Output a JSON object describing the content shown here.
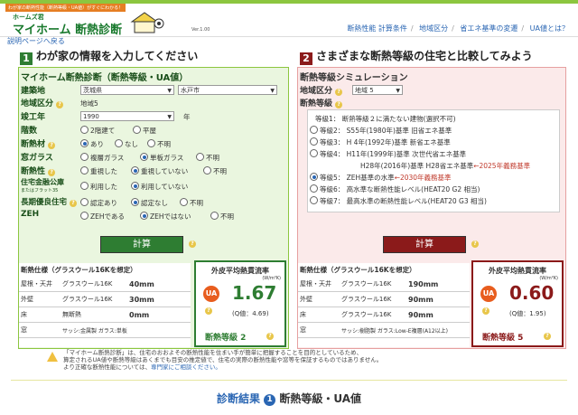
{
  "header": {
    "tagline": "わが家の断熱性能（断熱等級・UA値）がすぐにわかる！",
    "logo_small": "ホームズ君",
    "logo_main": "マイホーム 断熱診断",
    "version": "Ver.1.00",
    "nav": [
      "断熱性能 計算条件",
      "地域区分",
      "省エネ基準の変遷",
      "UA値とは？"
    ]
  },
  "back_link": "説明ページへ戻る",
  "left": {
    "section_num": "1",
    "section_title": "わが家の情報を入力してください",
    "panel_title": "マイホーム断熱診断（断熱等級・UA値）",
    "fields": {
      "location_label": "建築地",
      "prefecture": "茨城県",
      "city": "水戸市",
      "region_label": "地域区分",
      "region_value": "地域5",
      "year_label": "竣工年",
      "year_value": "1990",
      "year_unit": "年",
      "floors_label": "階数",
      "floors_opts": [
        "2階建て",
        "平屋"
      ],
      "insul_label": "断熱材",
      "insul_opts": [
        "あり",
        "なし",
        "不明"
      ],
      "window_label": "窓ガラス",
      "window_opts": [
        "複層ガラス",
        "単板ガラス",
        "不明"
      ],
      "renov_label": "断熱性",
      "renov_opts": [
        "重視した",
        "重視していない",
        "不明"
      ],
      "loan_label": "住宅金融公庫",
      "loan_sub": "またはフラット35",
      "loan_opts": [
        "利用した",
        "利用していない"
      ],
      "long_label": "長期優良住宅",
      "long_opts": [
        "認定あり",
        "認定なし",
        "不明"
      ],
      "zeh_label": "ZEH",
      "zeh_opts": [
        "ZEHである",
        "ZEHではない",
        "不明"
      ]
    },
    "calc_button": "計算",
    "spec_title": "断熱仕様（グラスウール16Kを想定）",
    "specs": [
      {
        "part": "屋根・天井",
        "mat": "グラスウール16K",
        "val": "40mm"
      },
      {
        "part": "外壁",
        "mat": "グラスウール16K",
        "val": "30mm"
      },
      {
        "part": "床",
        "mat": "無断熱",
        "val": "0mm"
      },
      {
        "part": "窓",
        "mat": "サッシ:金属製 ガラス:単板",
        "val": ""
      }
    ],
    "result": {
      "title": "外皮平均熱貫流率",
      "unit": "(W/m²K)",
      "ua_label": "UA",
      "value": "1.67",
      "q_value": "(Q値：4.69)",
      "grade": "断熱等級 2"
    }
  },
  "right": {
    "section_num": "2",
    "section_title": "さまざまな断熱等級の住宅と比較してみよう",
    "panel_title": "断熱等級シミュレーション",
    "region_label": "地域区分",
    "region_value": "地域 5",
    "grade_label": "断熱等級",
    "grades": [
      "等級1： 断熱等級２に満たない建物(選択不可)",
      "等級2： S55年(1980年)基準  旧省エネ基準",
      "等級3： H 4年(1992年)基準  新省エネ基準",
      "等級4： H11年(1999年)基準  次世代省エネ基準",
      "H28年(2016年)基準  H28省エネ基準",
      "等級5： ZEH基準の水準",
      "等級6： 高水準な断熱性能レベル(HEAT20 G2 相当)",
      "等級7： 最高水準の断熱性能レベル(HEAT20 G3 相当)"
    ],
    "note_2025": "←2025年義務基準",
    "note_2030": "←2030年義務基準",
    "calc_button": "計算",
    "spec_title": "断熱仕様（グラスウール16Kを想定）",
    "specs": [
      {
        "part": "屋根・天井",
        "mat": "グラスウール16K",
        "val": "190mm"
      },
      {
        "part": "外壁",
        "mat": "グラスウール16K",
        "val": "90mm"
      },
      {
        "part": "床",
        "mat": "グラスウール16K",
        "val": "90mm"
      },
      {
        "part": "窓",
        "mat": "サッシ:樹脂製 ガラス:Low-E複層(A12以上)",
        "val": ""
      }
    ],
    "result": {
      "title": "外皮平均熱貫流率",
      "unit": "(W/m²K)",
      "ua_label": "UA",
      "value": "0.60",
      "q_value": "(Q値：1.95)",
      "grade": "断熱等級 5"
    }
  },
  "notice": {
    "line1": "「マイホーム断熱診断」は、住宅のおおよその断熱性能を住まい手が簡単に把握することを目的としているため、",
    "line2": "算定されるUA値や断熱等級はあくまでも目安の推定値で、住宅の実際の断熱性能や窓等を保証するものではありません。",
    "line3": "より正確な断熱性能については、",
    "link": "専門家にご相談ください。"
  },
  "bottom": {
    "prefix": "診断結果",
    "num": "1",
    "text": "断熱等級・UA値"
  },
  "colors": {
    "green": "#1a7a2e",
    "calc_left": "#2e7d32",
    "calc_right": "#8b1a1a",
    "result_left": "#2e7d32",
    "result_right": "#8b1a1a"
  }
}
